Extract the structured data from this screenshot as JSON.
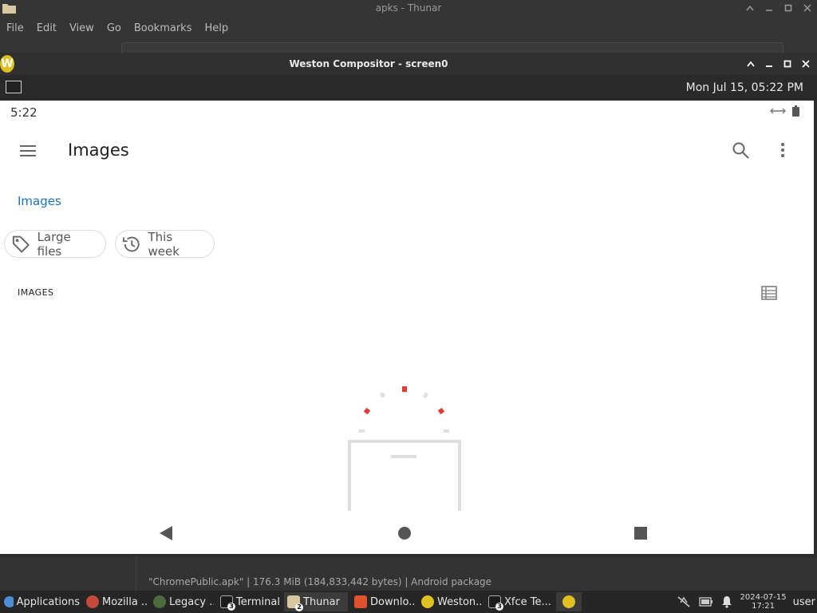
{
  "thunar": {
    "title": "apks - Thunar",
    "menu": [
      "File",
      "Edit",
      "View",
      "Go",
      "Bookmarks",
      "Help"
    ],
    "status_text": "\"ChromePublic.apk\"  |  176.3 MiB (184,833,442 bytes)  |  Android package"
  },
  "weston": {
    "title": "Weston Compositor - screen0",
    "logo": "W",
    "clock": "Mon Jul 15, 05:22 PM"
  },
  "android": {
    "status_time": "5:22",
    "app_title": "Images",
    "breadcrumb": "Images",
    "chips": [
      {
        "label": "Large files",
        "icon": "tag-icon"
      },
      {
        "label": "This week",
        "icon": "history-icon"
      }
    ],
    "section_header": "IMAGES",
    "accent_color": "#1a73b8",
    "loading_accent": "#e53935"
  },
  "taskbar": {
    "items": [
      {
        "label": "Applications",
        "icon": "xfce-menu-icon"
      },
      {
        "label": "Mozilla ...",
        "icon": "firefox-icon"
      },
      {
        "label": "Legacy ...",
        "icon": "legacy-app-icon"
      },
      {
        "label": "Terminal",
        "icon": "terminal-icon",
        "count": "3"
      },
      {
        "label": "Thunar",
        "icon": "folder-icon",
        "count": "2"
      },
      {
        "label": "Downlo...",
        "icon": "brave-icon"
      },
      {
        "label": "Weston...",
        "icon": "weston-icon"
      },
      {
        "label": "Xfce Te...",
        "icon": "terminal-icon",
        "count": "3"
      }
    ],
    "date": "2024-07-15",
    "time": "17:21",
    "user": "user"
  }
}
